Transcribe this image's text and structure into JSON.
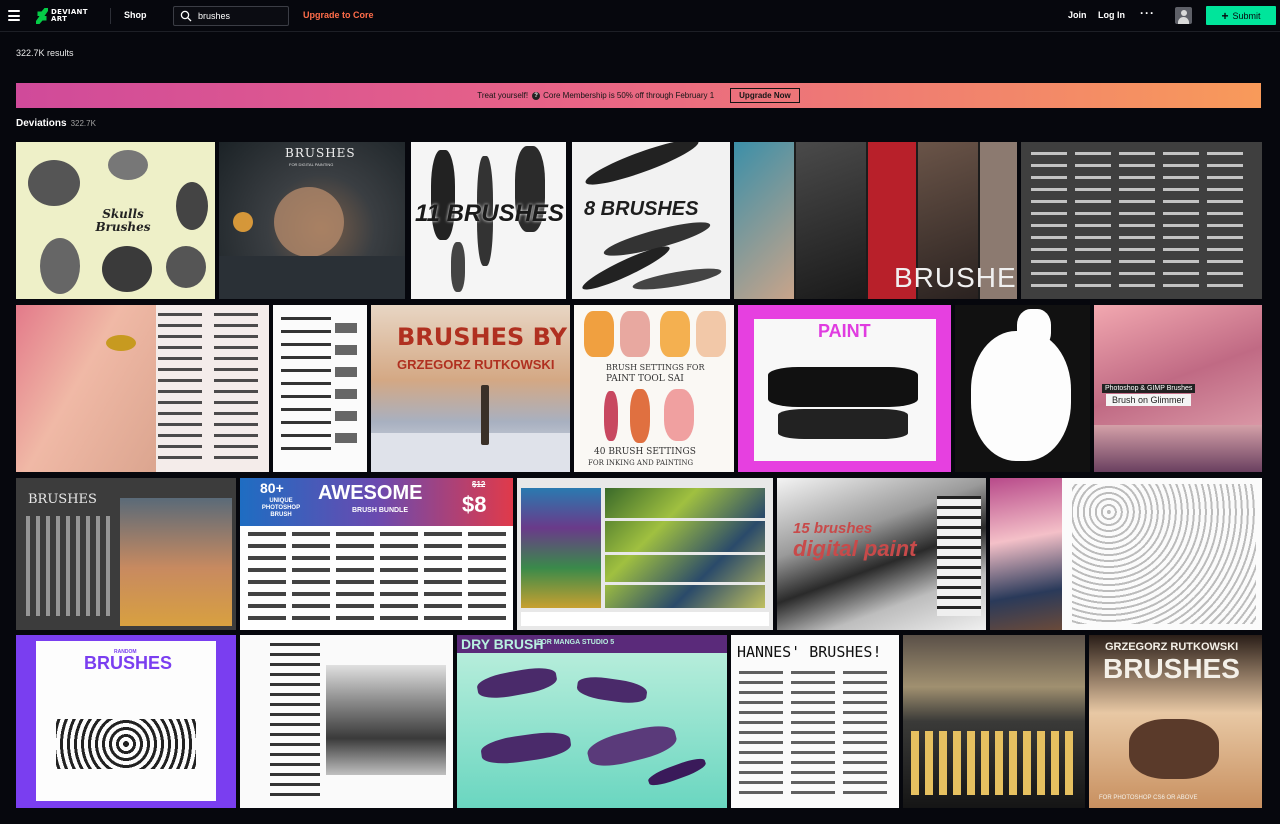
{
  "nav": {
    "brand_line1": "DEVIANT",
    "brand_line2": "ART",
    "shop": "Shop",
    "search_value": "brushes",
    "upgrade_link": "Upgrade to Core",
    "join": "Join",
    "login": "Log In",
    "more": "···",
    "submit": "Submit"
  },
  "results_count": "322.7K results",
  "banner": {
    "text_before": "Treat yourself!",
    "info_glyph": "?",
    "text_after": "Core Membership is 50% off through February 1",
    "cta": "Upgrade Now"
  },
  "section": {
    "title": "Deviations",
    "count": "322.7K"
  },
  "thumbnails": [
    {
      "caption": "Skulls Brushes"
    },
    {
      "caption": "BRUSHES",
      "sub": "FOR DIGITAL PAINTING"
    },
    {
      "caption": "11 BRUSHES"
    },
    {
      "caption": "8 BRUSHES"
    },
    {
      "caption": "BRUSHES"
    },
    {
      "caption": ""
    },
    {
      "caption": ""
    },
    {
      "caption": ""
    },
    {
      "caption": "BRUSHES BY",
      "sub": "GRZEGORZ RUTKOWSKI"
    },
    {
      "caption": "BRUSH SETTINGS FOR",
      "sub": "PAINT TOOL SAI",
      "sub2": "40 BRUSH SETTINGS",
      "sub3": "FOR INKING AND PAINTING"
    },
    {
      "caption": "PAINT"
    },
    {
      "caption": ""
    },
    {
      "caption": "Photoshop & GIMP Brushes",
      "sub": "Brush on Glimmer"
    },
    {
      "caption": "BRUSHES"
    },
    {
      "caption": "80+",
      "sub": "UNIQUE PHOTOSHOP BRUSH",
      "sub2": "AWESOME",
      "sub3": "BRUSH BUNDLE",
      "price_old": "$12",
      "price": "$8"
    },
    {
      "caption": ""
    },
    {
      "caption": "15 brushes",
      "sub": "digital paint"
    },
    {
      "caption": ""
    },
    {
      "caption": "RANDOM",
      "sub": "BRUSHES"
    },
    {
      "caption": ""
    },
    {
      "caption": "DRY BRUSH",
      "sub": "FOR MANGA STUDIO 5"
    },
    {
      "caption": "HANNES' BRUSHES!"
    },
    {
      "caption": ""
    },
    {
      "caption": "GRZEGORZ RUTKOWSKI",
      "sub": "BRUSHES",
      "sub2": "FOR PHOTOSHOP CS6 OR ABOVE"
    }
  ],
  "colors": {
    "background": "#06070d",
    "accent_green": "#00e59b",
    "upgrade_orange": "#ff6d4a",
    "banner_start": "#d04a9a",
    "banner_end": "#f89a5a"
  }
}
